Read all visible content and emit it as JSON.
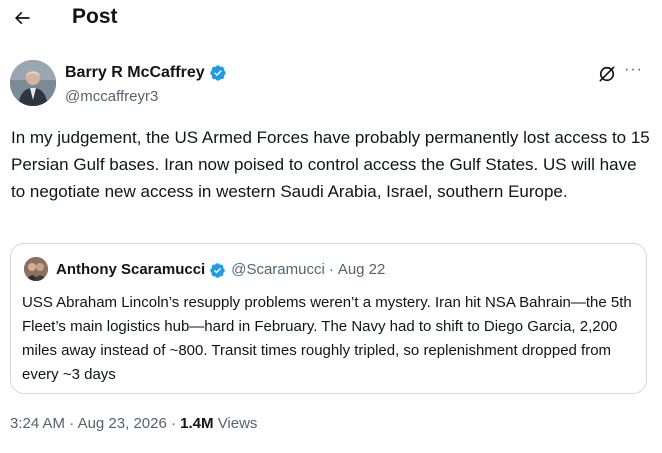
{
  "header": {
    "title": "Post",
    "back_icon": "arrow-left-icon"
  },
  "post": {
    "author": {
      "name": "Barry R McCaffrey",
      "handle": "@mccaffreyr3",
      "verified": true,
      "verified_color": "#1d9bf0"
    },
    "actions": {
      "grok_icon": "grok-icon",
      "more_label": "···"
    },
    "text": "In my judgement, the US Armed Forces have probably permanently lost access to 15 Persian Gulf bases. Iran now poised to control access the Gulf States. US will have to negotiate new access in western Saudi Arabia, Israel, southern Europe.",
    "quote": {
      "name": "Anthony Scaramucci",
      "handle": "@Scaramucci",
      "separator": "·",
      "date": "Aug 22",
      "verified": true,
      "text": "USS Abraham Lincoln’s resupply problems weren’t a mystery. Iran hit NSA Bahrain—the 5th Fleet’s main logistics hub—hard in February. The Navy had to shift to Diego Garcia, 2,200 miles away instead of ~800. Transit times roughly tripled, so replenishment dropped from every ~3 days"
    },
    "meta": {
      "time": "3:24 AM",
      "separator": "·",
      "date": "Aug 23, 2026",
      "views_count": "1.4M",
      "views_label": "Views"
    }
  }
}
